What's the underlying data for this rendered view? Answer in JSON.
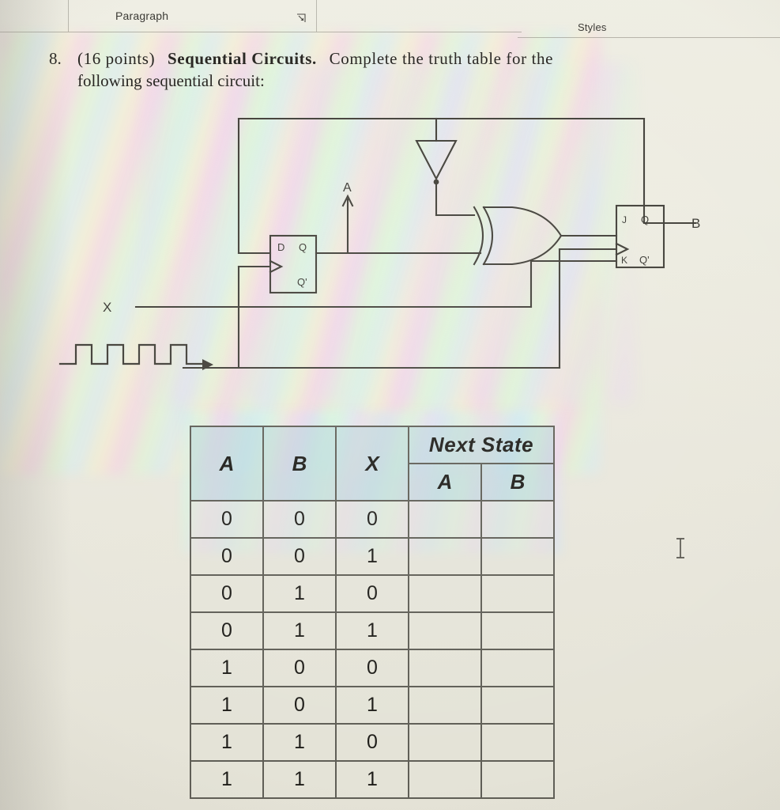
{
  "ribbon": {
    "paragraph_group_label": "Paragraph",
    "styles_group_label": "Styles",
    "dialog_launcher_icon": "dialog-box-launcher-icon"
  },
  "document": {
    "question_number": "8.",
    "points": "(16 points)",
    "title_bold": "Sequential Circuits.",
    "prompt_rest": "Complete the truth table for the",
    "line2": "following sequential circuit:"
  },
  "circuit": {
    "labels": {
      "input_x": "X",
      "node_a": "A",
      "output_b": "B",
      "dff_d": "D",
      "dff_q": "Q",
      "dff_qbar": "Q'",
      "jkff_j": "J",
      "jkff_k": "K",
      "jkff_q": "Q",
      "jkff_qbar": "Q'"
    },
    "components": [
      {
        "name": "d-flip-flop",
        "inputs": [
          "D",
          "CLK"
        ],
        "outputs": [
          "Q",
          "Q'"
        ]
      },
      {
        "name": "jk-flip-flop",
        "inputs": [
          "J",
          "CLK",
          "K"
        ],
        "outputs": [
          "Q",
          "Q'"
        ]
      },
      {
        "name": "inverter",
        "inputs": 1,
        "outputs": 1
      },
      {
        "name": "xor-gate",
        "inputs": 2,
        "outputs": 1
      }
    ],
    "clock_waveform": {
      "pulses": 4,
      "has_arrow": true
    },
    "wire_color": "#413f38"
  },
  "truth_table": {
    "group_header": "Next State",
    "columns": [
      "A",
      "B",
      "X"
    ],
    "next_state_columns": [
      "A",
      "B"
    ],
    "rows": [
      {
        "A": "0",
        "B": "0",
        "X": "0",
        "next_A": "",
        "next_B": ""
      },
      {
        "A": "0",
        "B": "0",
        "X": "1",
        "next_A": "",
        "next_B": ""
      },
      {
        "A": "0",
        "B": "1",
        "X": "0",
        "next_A": "",
        "next_B": ""
      },
      {
        "A": "0",
        "B": "1",
        "X": "1",
        "next_A": "",
        "next_B": ""
      },
      {
        "A": "1",
        "B": "0",
        "X": "0",
        "next_A": "",
        "next_B": ""
      },
      {
        "A": "1",
        "B": "0",
        "X": "1",
        "next_A": "",
        "next_B": ""
      },
      {
        "A": "1",
        "B": "1",
        "X": "0",
        "next_A": "",
        "next_B": ""
      },
      {
        "A": "1",
        "B": "1",
        "X": "1",
        "next_A": "",
        "next_B": ""
      }
    ]
  },
  "cursor": {
    "icon": "text-ibeam-cursor"
  }
}
